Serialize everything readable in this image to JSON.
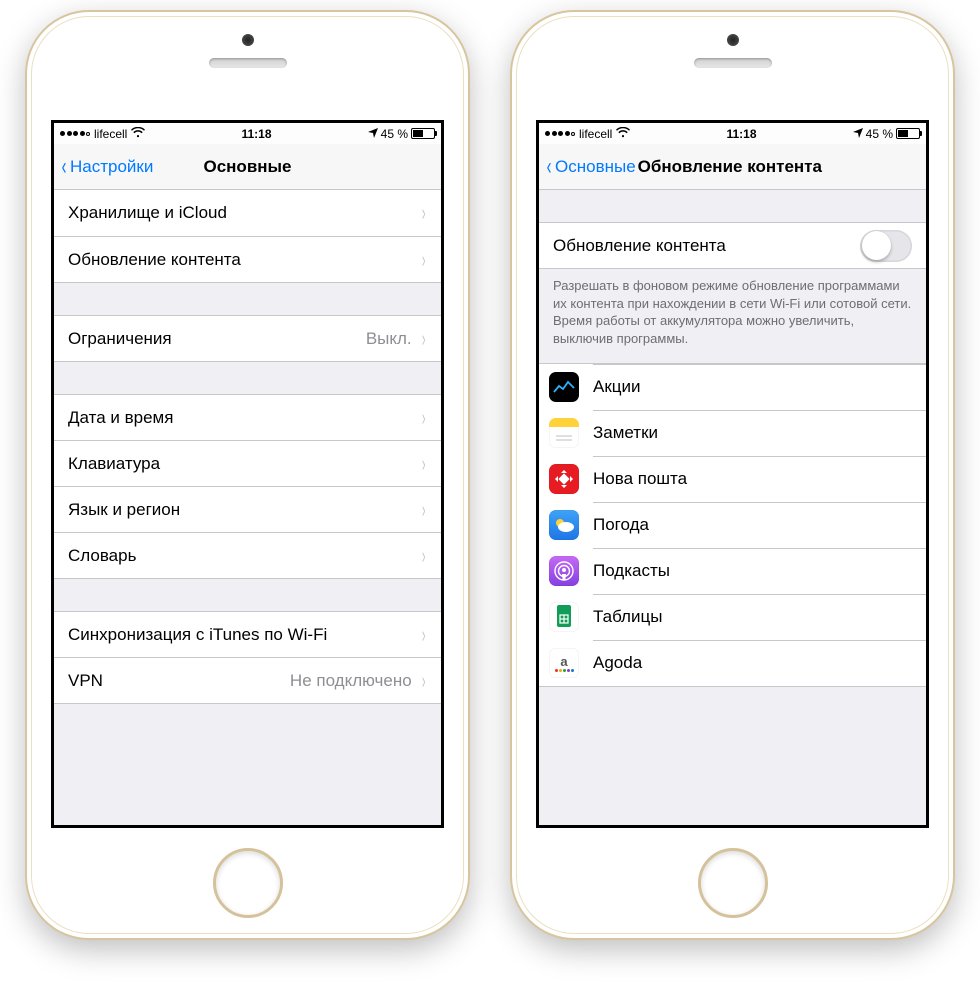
{
  "statusbar": {
    "carrier": "lifecell",
    "time": "11:18",
    "battery_pct": "45 %"
  },
  "left_screen": {
    "nav": {
      "back": "Настройки",
      "title": "Основные"
    },
    "group1": [
      {
        "label": "Хранилище и iCloud"
      },
      {
        "label": "Обновление контента"
      }
    ],
    "group2": [
      {
        "label": "Ограничения",
        "detail": "Выкл."
      }
    ],
    "group3": [
      {
        "label": "Дата и время"
      },
      {
        "label": "Клавиатура"
      },
      {
        "label": "Язык и регион"
      },
      {
        "label": "Словарь"
      }
    ],
    "group4": [
      {
        "label": "Синхронизация с iTunes по Wi-Fi"
      },
      {
        "label": "VPN",
        "detail": "Не подключено"
      }
    ]
  },
  "right_screen": {
    "nav": {
      "back": "Основные",
      "title": "Обновление контента"
    },
    "master_toggle": {
      "label": "Обновление контента",
      "on": false
    },
    "footer": "Разрешать в фоновом режиме обновление программами их контента при нахождении в сети Wi-Fi или сотовой сети. Время работы от аккумулятора можно увеличить, выключив программы.",
    "apps": [
      {
        "name": "Акции",
        "icon": "stocks"
      },
      {
        "name": "Заметки",
        "icon": "notes"
      },
      {
        "name": "Нова пошта",
        "icon": "novaposhta"
      },
      {
        "name": "Погода",
        "icon": "weather"
      },
      {
        "name": "Подкасты",
        "icon": "podcasts"
      },
      {
        "name": "Таблицы",
        "icon": "sheets"
      },
      {
        "name": "Agoda",
        "icon": "agoda"
      }
    ]
  }
}
